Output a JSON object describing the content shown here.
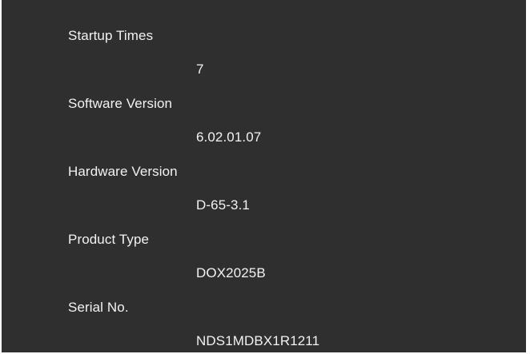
{
  "info": {
    "fields": [
      {
        "label": "Startup Times",
        "value": "7"
      },
      {
        "label": "Software Version",
        "value": "6.02.01.07"
      },
      {
        "label": "Hardware Version",
        "value": "D-65-3.1"
      },
      {
        "label": "Product Type",
        "value": "DOX2025B"
      },
      {
        "label": "Serial No.",
        "value": "NDS1MDBX1R1211"
      }
    ]
  }
}
